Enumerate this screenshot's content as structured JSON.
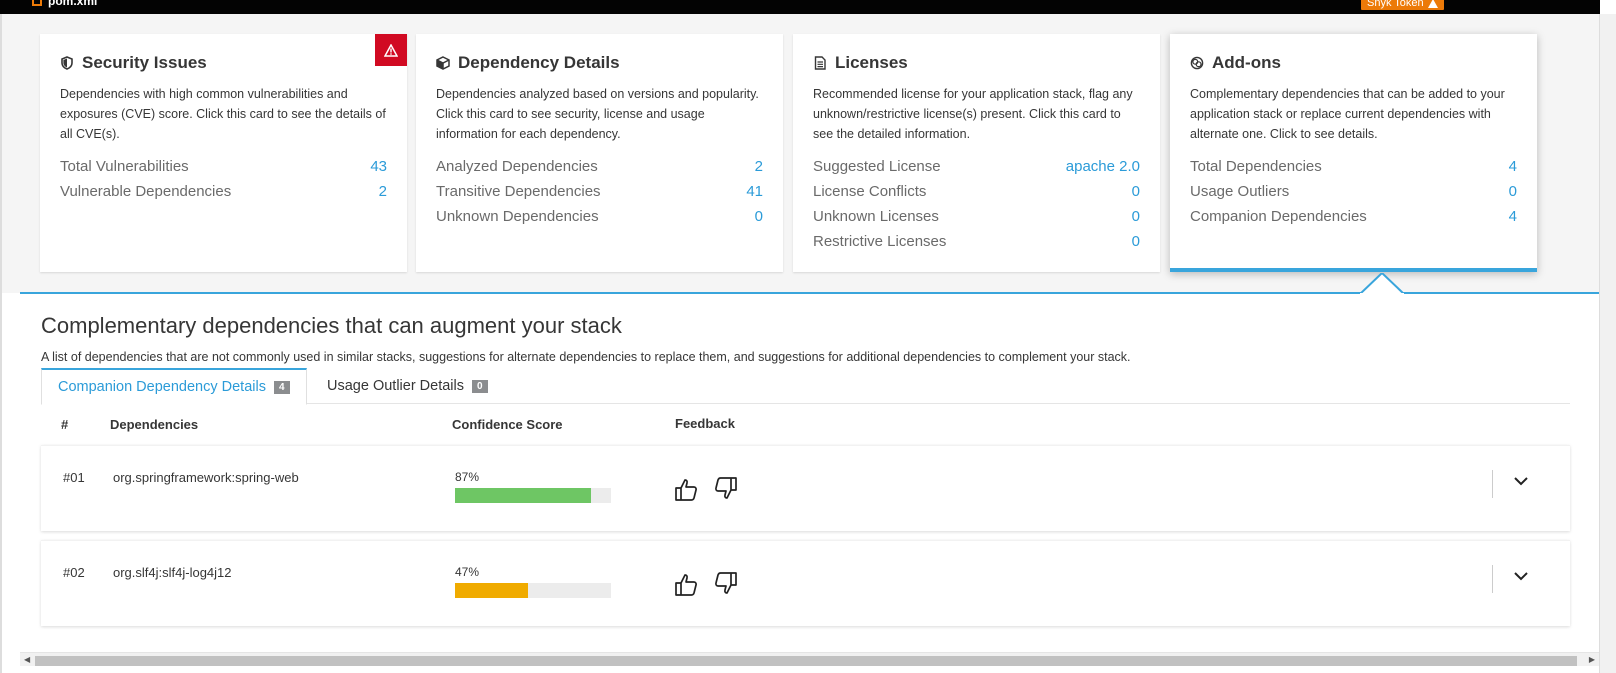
{
  "topbar": {
    "file_name": "pom.xml",
    "snyk_label": "Snyk Token"
  },
  "cards": [
    {
      "title": "Security Issues",
      "description": "Dependencies with high common vulnerabilities and exposures (CVE) score. Click this card to see the details of all CVE(s).",
      "rows": [
        {
          "label": "Total Vulnerabilities",
          "value": "43"
        },
        {
          "label": "Vulnerable Dependencies",
          "value": "2"
        }
      ]
    },
    {
      "title": "Dependency Details",
      "description": "Dependencies analyzed based on versions and popularity. Click this card to see security, license and usage information for each dependency.",
      "rows": [
        {
          "label": "Analyzed Dependencies",
          "value": "2"
        },
        {
          "label": "Transitive Dependencies",
          "value": "41"
        },
        {
          "label": "Unknown Dependencies",
          "value": "0"
        }
      ]
    },
    {
      "title": "Licenses",
      "description": "Recommended license for your application stack, flag any unknown/restrictive license(s) present. Click this card to see the detailed information.",
      "rows": [
        {
          "label": "Suggested License",
          "value": "apache 2.0"
        },
        {
          "label": "License Conflicts",
          "value": "0"
        },
        {
          "label": "Unknown Licenses",
          "value": "0"
        },
        {
          "label": "Restrictive Licenses",
          "value": "0"
        }
      ]
    },
    {
      "title": "Add-ons",
      "description": "Complementary dependencies that can be added to your application stack or replace current dependencies with alternate one. Click to see details.",
      "rows": [
        {
          "label": "Total Dependencies",
          "value": "4"
        },
        {
          "label": "Usage Outliers",
          "value": "0"
        },
        {
          "label": "Companion Dependencies",
          "value": "4"
        }
      ]
    }
  ],
  "section": {
    "title": "Complementary dependencies that can augment your stack",
    "description": "A list of dependencies that are not commonly used in similar stacks, suggestions for alternate dependencies to replace them, and suggestions for additional dependencies to complement your stack."
  },
  "tabs": [
    {
      "label": "Companion Dependency Details",
      "count": "4"
    },
    {
      "label": "Usage Outlier Details",
      "count": "0"
    }
  ],
  "table": {
    "headers": {
      "num": "#",
      "deps": "Dependencies",
      "score": "Confidence Score",
      "feedback": "Feedback"
    },
    "rows": [
      {
        "num": "#01",
        "dependency": "org.springframework:spring-web",
        "score_label": "87%",
        "score": 0.87,
        "bar_color": "#6ec664"
      },
      {
        "num": "#02",
        "dependency": "org.slf4j:slf4j-log4j12",
        "score_label": "47%",
        "score": 0.47,
        "bar_color": "#f0ab00"
      }
    ]
  },
  "colors": {
    "accent": "#39a5dc",
    "link": "#2b9bd8",
    "danger": "#d10a22",
    "warning": "#ec7a08"
  },
  "icons": [
    "shield-icon",
    "cube-icon",
    "document-icon",
    "addons-icon",
    "warning-icon",
    "thumbs-up-icon",
    "thumbs-down-icon",
    "chevron-down-icon"
  ]
}
